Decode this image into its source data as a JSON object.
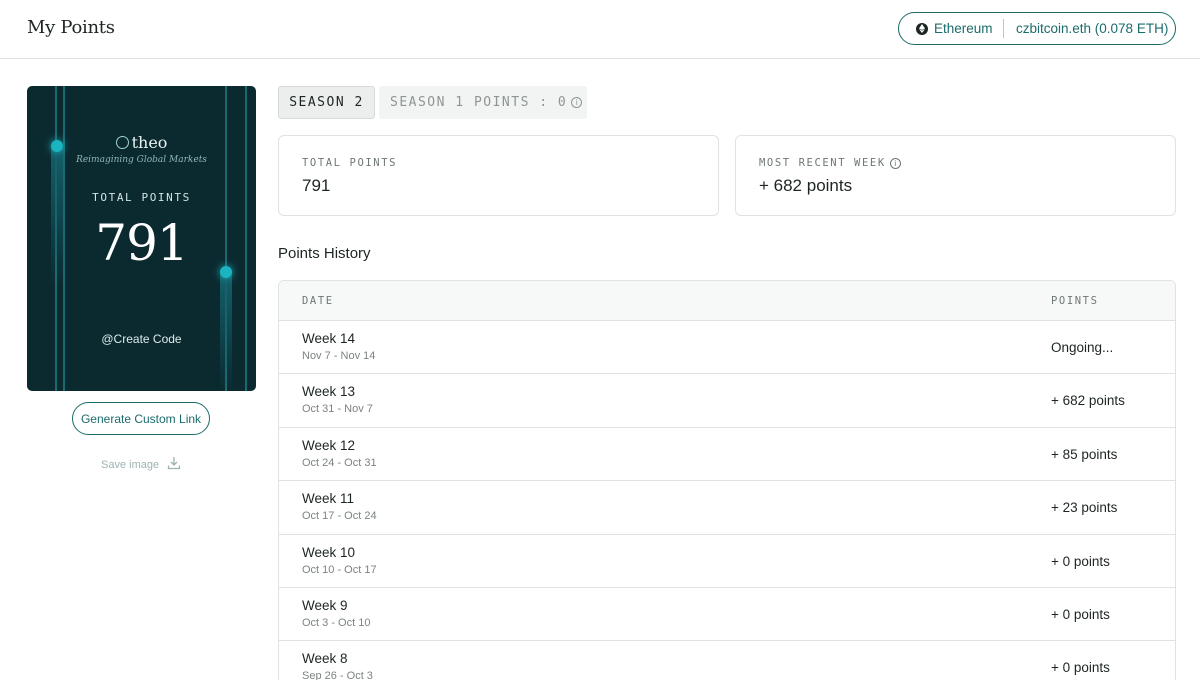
{
  "header": {
    "title": "My Points",
    "network": "Ethereum",
    "account": "czbitcoin.eth (0.078 ETH)"
  },
  "card": {
    "brand": "theo",
    "tagline": "Reimagining Global Markets",
    "total_label": "TOTAL POINTS",
    "total_value": "791",
    "code_label": "@Create Code"
  },
  "actions": {
    "generate_label": "Generate Custom Link",
    "save_label": "Save image"
  },
  "tabs": {
    "season2": "SEASON 2",
    "season1": "SEASON 1 POINTS : 0"
  },
  "stats": {
    "total_label": "TOTAL POINTS",
    "total_value": "791",
    "recent_label": "MOST RECENT WEEK",
    "recent_value": "+ 682 points"
  },
  "history": {
    "title": "Points History",
    "columns": {
      "date": "DATE",
      "points": "POINTS"
    },
    "rows": [
      {
        "week": "Week 14",
        "range": "Nov 7 - Nov 14",
        "points": "Ongoing..."
      },
      {
        "week": "Week 13",
        "range": "Oct 31 - Nov 7",
        "points": "+ 682 points"
      },
      {
        "week": "Week 12",
        "range": "Oct 24 - Oct 31",
        "points": "+ 85 points"
      },
      {
        "week": "Week 11",
        "range": "Oct 17 - Oct 24",
        "points": "+ 23 points"
      },
      {
        "week": "Week 10",
        "range": "Oct 10 - Oct 17",
        "points": "+ 0 points"
      },
      {
        "week": "Week 9",
        "range": "Oct 3 - Oct 10",
        "points": "+ 0 points"
      },
      {
        "week": "Week 8",
        "range": "Sep 26 - Oct 3",
        "points": "+ 0 points"
      }
    ]
  },
  "colors": {
    "accent": "#1c6b6b",
    "card_bg": "#0b2a30",
    "card_glow": "#1ab3bf"
  },
  "icons": [
    "ethereum-icon",
    "info-icon",
    "download-icon",
    "theo-logo-icon"
  ]
}
